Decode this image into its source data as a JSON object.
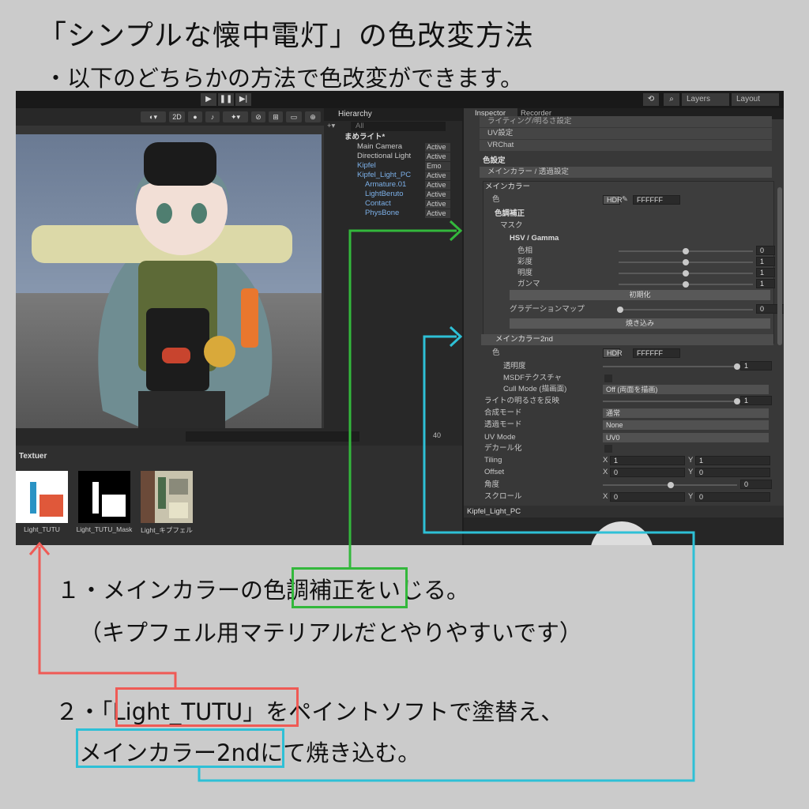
{
  "header": {
    "title": "「シンプルな懐中電灯」の色改変方法",
    "subtitle": "・以下のどちらかの方法で色改変ができます。"
  },
  "unity": {
    "toolbar": {
      "layers": "Layers",
      "layout": "Layout",
      "play": "▶",
      "pause": "❚❚",
      "step": "▶|"
    },
    "scene": {
      "mode_2d": "2D"
    },
    "hierarchy": {
      "title": "Hierarchy",
      "search": "All",
      "root": "まめライト*",
      "items": [
        {
          "label": "Main Camera",
          "status": "Active",
          "indent": 1,
          "blue": false
        },
        {
          "label": "Directional Light",
          "status": "Active",
          "indent": 1,
          "blue": false
        },
        {
          "label": "Kipfel",
          "status": "Emo",
          "indent": 1,
          "blue": true
        },
        {
          "label": "Kipfel_Light_PC",
          "status": "Active",
          "indent": 1,
          "blue": true
        },
        {
          "label": "Armature.01",
          "status": "Active",
          "indent": 2,
          "blue": true
        },
        {
          "label": "LightBeruto",
          "status": "Active",
          "indent": 2,
          "blue": true
        },
        {
          "label": "Contact",
          "status": "Active",
          "indent": 2,
          "blue": true
        },
        {
          "label": "PhysBone",
          "status": "Active",
          "indent": 2,
          "blue": true
        }
      ]
    },
    "inspector": {
      "tab_inspector": "Inspector",
      "tab_recorder": "Recorder",
      "top_rows": [
        "ライティング/明るさ設定",
        "UV設定",
        "VRChat"
      ],
      "color_section": "色設定",
      "main_header": "メインカラー / 透過設定",
      "main_box": "メインカラー",
      "color_label": "色",
      "hdr": "HDR",
      "hex": "FFFFFF",
      "correction": "色調補正",
      "mask": "マスク",
      "hsv": "HSV / Gamma",
      "hsv_rows": [
        {
          "label": "色相",
          "value": "0"
        },
        {
          "label": "彩度",
          "value": "1"
        },
        {
          "label": "明度",
          "value": "1"
        },
        {
          "label": "ガンマ",
          "value": "1"
        }
      ],
      "reset": "初期化",
      "gradation": "グラデーションマップ",
      "grad_value": "0",
      "bake": "焼き込み",
      "second": "メインカラー2nd",
      "color2_label": "色",
      "hex2": "FFFFFF",
      "opacity": "透明度",
      "opacity_value": "1",
      "msdf": "MSDFテクスチャ",
      "cull": "Cull Mode (描画面)",
      "cull_value": "Off (両面を描画)",
      "light_ref": "ライトの明るさを反映",
      "light_value": "1",
      "blend": "合成モード",
      "blend_value": "通常",
      "trans": "透過モード",
      "trans_value": "None",
      "uvmode": "UV Mode",
      "uvmode_value": "UV0",
      "decal": "デカール化",
      "tiling": "Tiling",
      "tiling_x": "1",
      "tiling_y": "1",
      "offset": "Offset",
      "offset_x": "0",
      "offset_y": "0",
      "angle": "角度",
      "angle_value": "0",
      "scroll": "スクロール",
      "scroll_x": "0",
      "scroll_y": "0",
      "xl": "X",
      "yl": "Y"
    },
    "project": {
      "folder": "Textuer",
      "count": "40",
      "textures": [
        "Light_TUTU",
        "Light_TUTU_Mask",
        "Light_キプフェル"
      ]
    },
    "preview": {
      "label": "Kipfel_Light_PC"
    }
  },
  "instructions": {
    "step1_pre": "１・メインカラーの",
    "step1_hl": "色調補正",
    "step1_post": "をいじる。",
    "step1_note": "（キプフェル用マテリアルだとやりやすいです）",
    "step2_pre": "２・",
    "step2_hl": "「Light_TUTU」",
    "step2_post": "をペイントソフトで塗替え、",
    "step2b_hl": "メインカラー2nd",
    "step2b_post": "にて焼き込む。"
  },
  "colors": {
    "green": "#33b83c",
    "red": "#ef5a55",
    "cyan": "#2ec0d6"
  }
}
